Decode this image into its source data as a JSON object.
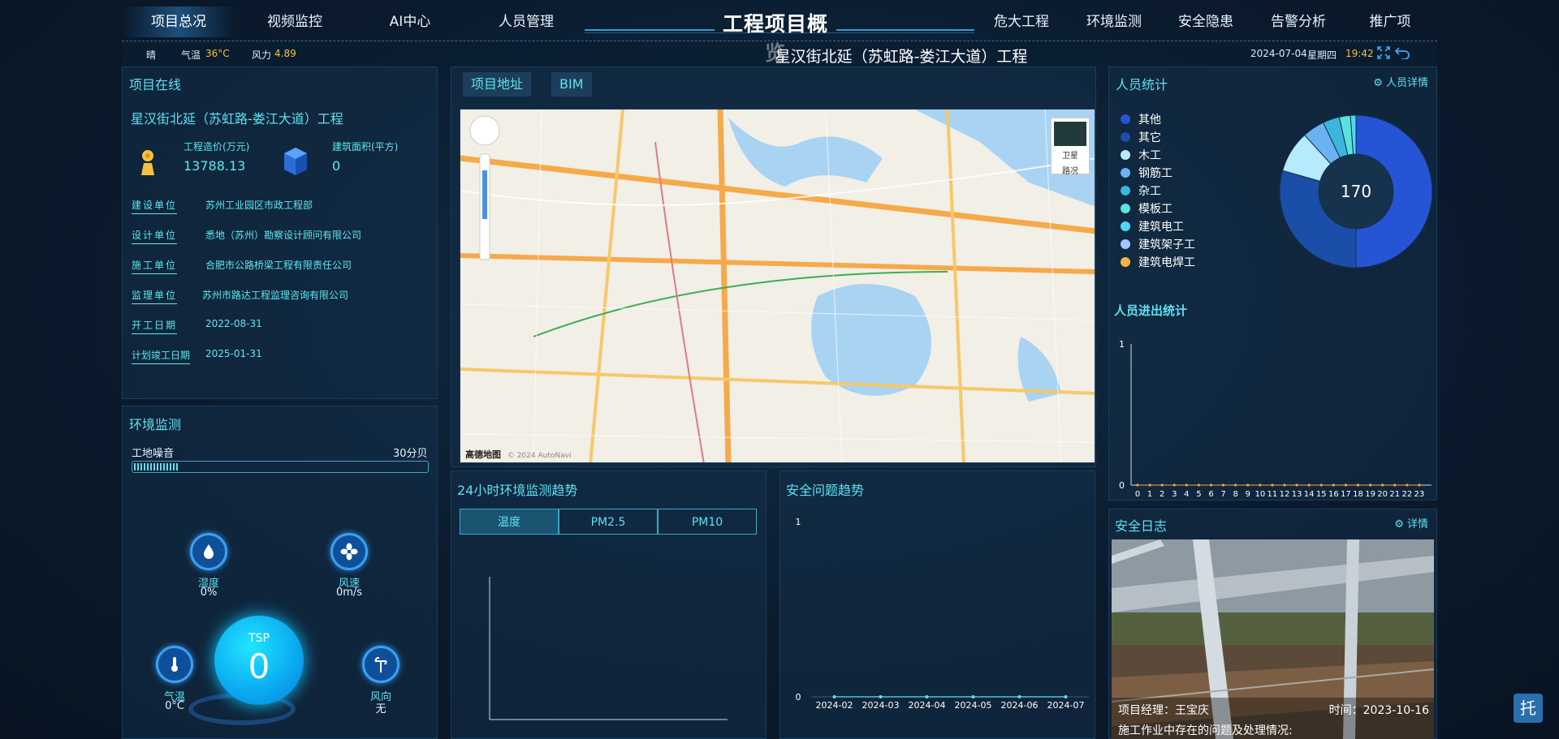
{
  "nav": {
    "left": [
      "项目总况",
      "视频监控",
      "AI中心",
      "人员管理"
    ],
    "right": [
      "危大工程",
      "环境监测",
      "安全隐患",
      "告警分析",
      "推广项"
    ],
    "title": "工程项目概览"
  },
  "infobar": {
    "weather": "晴",
    "temp_label": "气温",
    "temp_value": "36°C",
    "wind_label": "风力",
    "wind_value": "4.89",
    "project_name": "星汉街北延（苏虹路-娄江大道）工程",
    "date": "2024-07-04",
    "weekday": "星期四",
    "time": "19:42"
  },
  "project_panel": {
    "title": "项目在线",
    "name": "星汉街北延（苏虹路-娄江大道）工程",
    "cost_label": "工程造价(万元)",
    "cost_value": "13788.13",
    "area_label": "建筑面积(平方)",
    "area_value": "0",
    "rows": [
      {
        "label": "建设单位",
        "value": "苏州工业园区市政工程部"
      },
      {
        "label": "设计单位",
        "value": "悉地（苏州）勘察设计顾问有限公司"
      },
      {
        "label": "施工单位",
        "value": "合肥市公路桥梁工程有限责任公司"
      },
      {
        "label": "监理单位",
        "value": "苏州市路达工程监理咨询有限公司"
      },
      {
        "label": "开工日期",
        "value": "2022-08-31"
      },
      {
        "label": "计划竣工日期",
        "value": "2025-01-31"
      }
    ]
  },
  "env_panel": {
    "title": "环境监测",
    "noise_label": "工地噪音",
    "noise_value": "30分贝",
    "noise_fraction": 0.15,
    "humidity_label": "湿度",
    "humidity_value": "0%",
    "windspeed_label": "风速",
    "windspeed_value": "0m/s",
    "temp_label": "气温",
    "temp_value": "0°C",
    "tsp_label": "TSP",
    "tsp_value": "0",
    "winddir_label": "风向",
    "winddir_value": "无"
  },
  "map_panel": {
    "tabs": [
      "项目地址",
      "BIM"
    ],
    "layer_satellite": "卫星",
    "layer_road": "路况",
    "brand": "高德地图",
    "copyright": "© 2024 AutoNavi"
  },
  "env_trend": {
    "title": "24小时环境监测趋势",
    "tabs": [
      "温度",
      "PM2.5",
      "PM10"
    ]
  },
  "safety_trend": {
    "title": "安全问题趋势",
    "chart_data": {
      "type": "line",
      "x": [
        "2024-02",
        "2024-03",
        "2024-04",
        "2024-05",
        "2024-06",
        "2024-07"
      ],
      "values": [
        0,
        0,
        0,
        0,
        0,
        0
      ],
      "ylim": [
        0,
        1
      ],
      "yticks": [
        "1",
        "0"
      ]
    }
  },
  "people_panel": {
    "title": "人员统计",
    "detail_link": "人员详情",
    "total": "170",
    "legend": [
      {
        "name": "其他",
        "color": "#2554d6"
      },
      {
        "name": "其它",
        "color": "#1a4ea8"
      },
      {
        "name": "木工",
        "color": "#b6eafc"
      },
      {
        "name": "钢筋工",
        "color": "#6cb2f2"
      },
      {
        "name": "杂工",
        "color": "#3ab6dc"
      },
      {
        "name": "模板工",
        "color": "#5ce2dc"
      },
      {
        "name": "建筑电工",
        "color": "#4fd6f6"
      },
      {
        "name": "建筑架子工",
        "color": "#a0c8ff"
      },
      {
        "name": "建筑电焊工",
        "color": "#f5b440"
      }
    ],
    "chart_data": {
      "type": "pie",
      "categories": [
        "其他",
        "其它",
        "木工",
        "钢筋工",
        "杂工",
        "模板工",
        "建筑电工",
        "建筑架子工",
        "建筑电焊工"
      ],
      "values": [
        85,
        50,
        15,
        8,
        6,
        4,
        2,
        0,
        0
      ]
    }
  },
  "access_panel": {
    "title": "人员进出统计",
    "chart_data": {
      "type": "line",
      "x": [
        "0",
        "1",
        "2",
        "3",
        "4",
        "5",
        "6",
        "7",
        "8",
        "9",
        "10",
        "11",
        "12",
        "13",
        "14",
        "15",
        "16",
        "17",
        "18",
        "19",
        "20",
        "21",
        "22",
        "23"
      ],
      "values": [
        0,
        0,
        0,
        0,
        0,
        0,
        0,
        0,
        0,
        0,
        0,
        0,
        0,
        0,
        0,
        0,
        0,
        0,
        0,
        0,
        0,
        0,
        0,
        0
      ],
      "ylim": [
        0,
        1
      ],
      "yticks": [
        "1",
        "0"
      ]
    }
  },
  "safety_log": {
    "title": "安全日志",
    "detail_link": "详情",
    "manager": "项目经理：王宝庆",
    "time": "时间：2023-10-16",
    "desc": "施工作业中存在的问题及处理情况:"
  },
  "float_button": "托"
}
